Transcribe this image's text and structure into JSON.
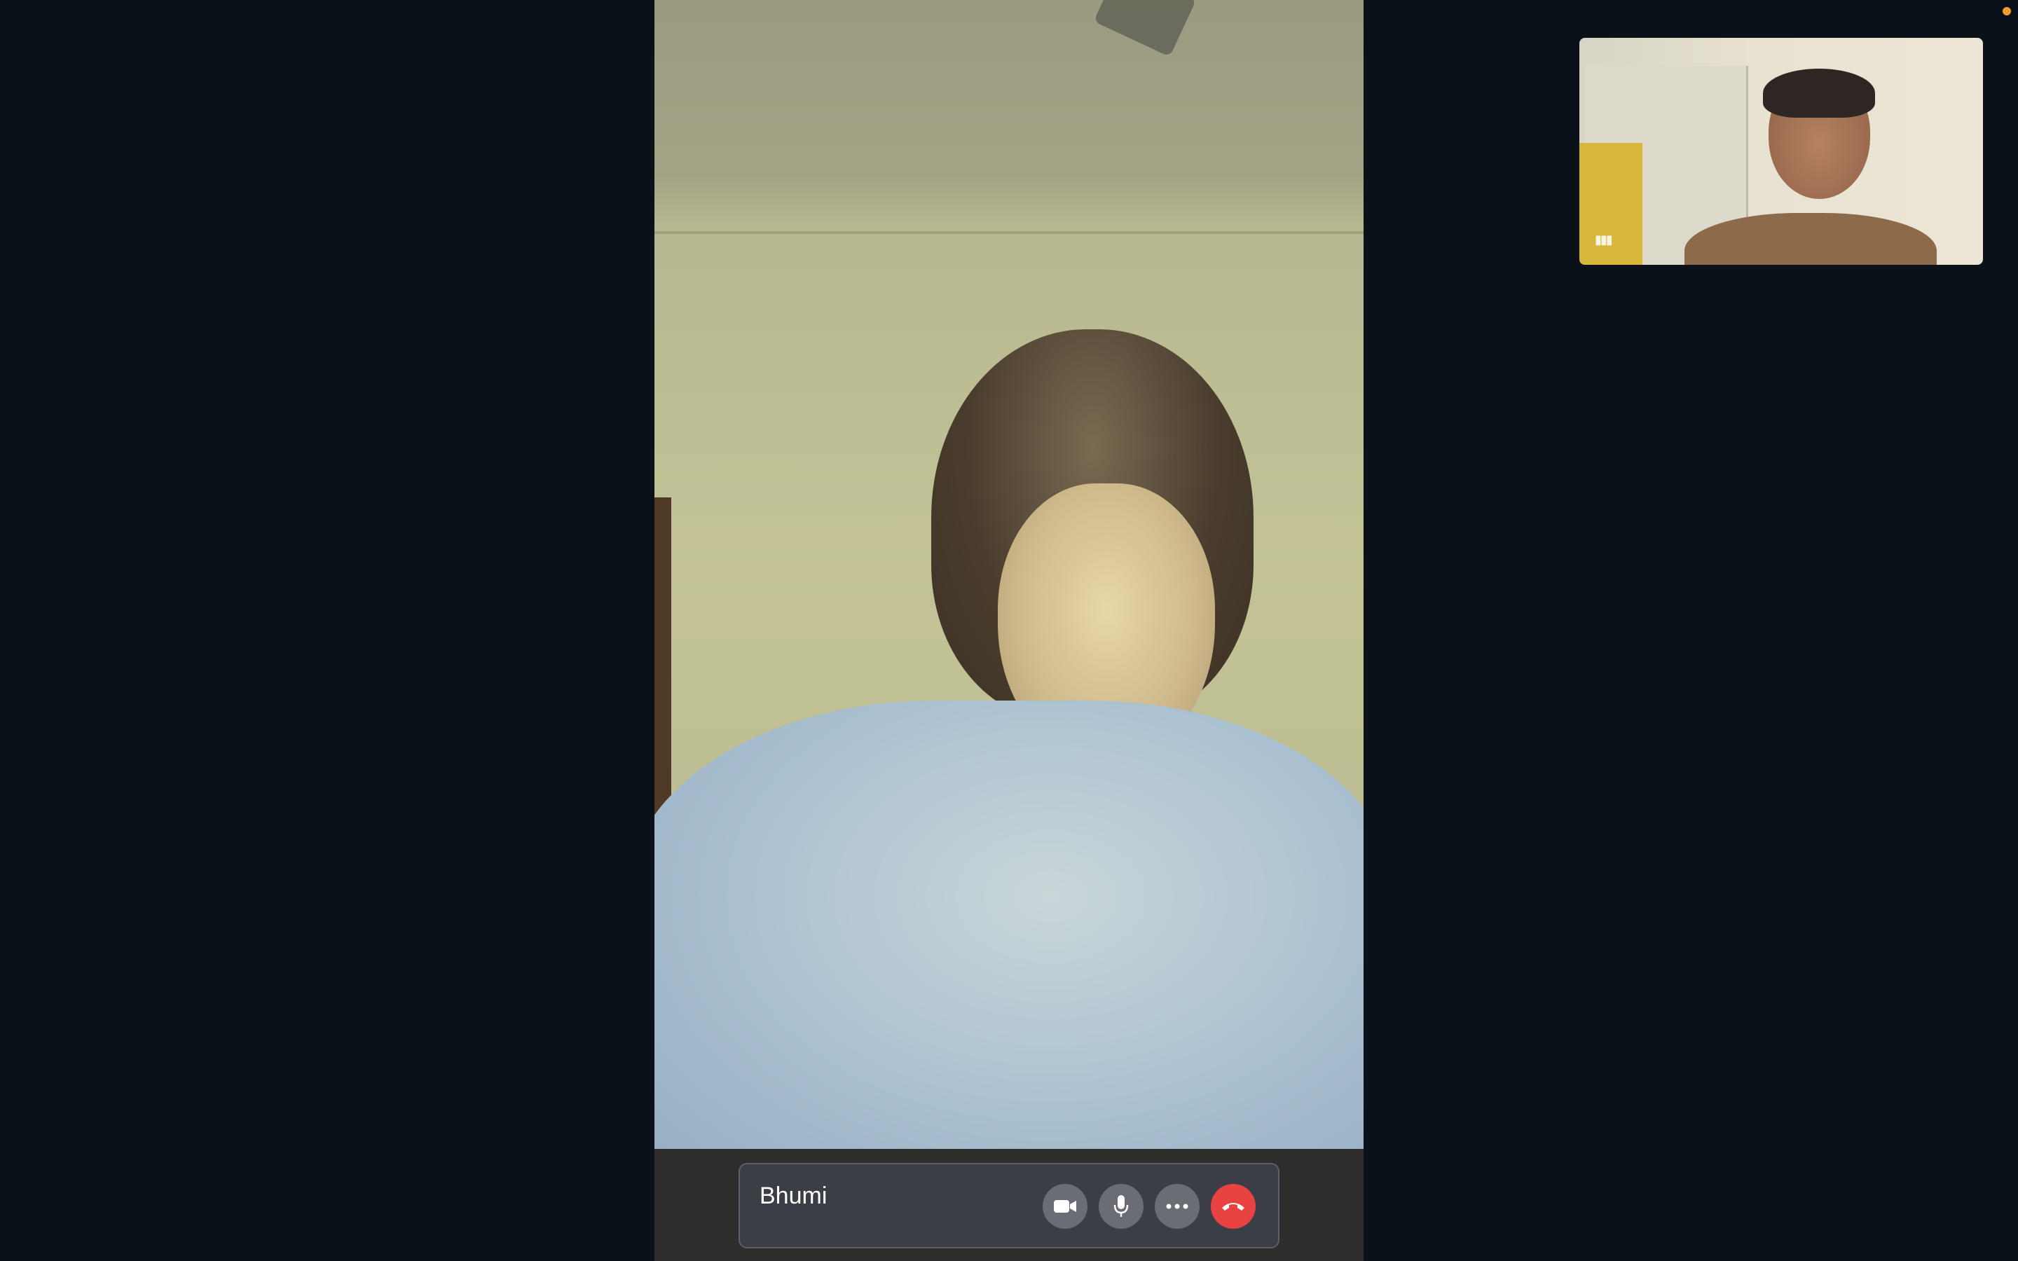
{
  "call": {
    "remote_participant_name": "Bhumi"
  },
  "controls": {
    "video_icon": "video-camera-icon",
    "mic_icon": "microphone-icon",
    "more_icon": "more-options-icon",
    "end_icon": "end-call-icon"
  },
  "self_view": {
    "audio_indicator_icon": "audio-level-icon"
  },
  "colors": {
    "background": "#0b1119",
    "control_button": "#6a6e74",
    "end_call": "#e84340",
    "status_dot": "#f29d38"
  }
}
